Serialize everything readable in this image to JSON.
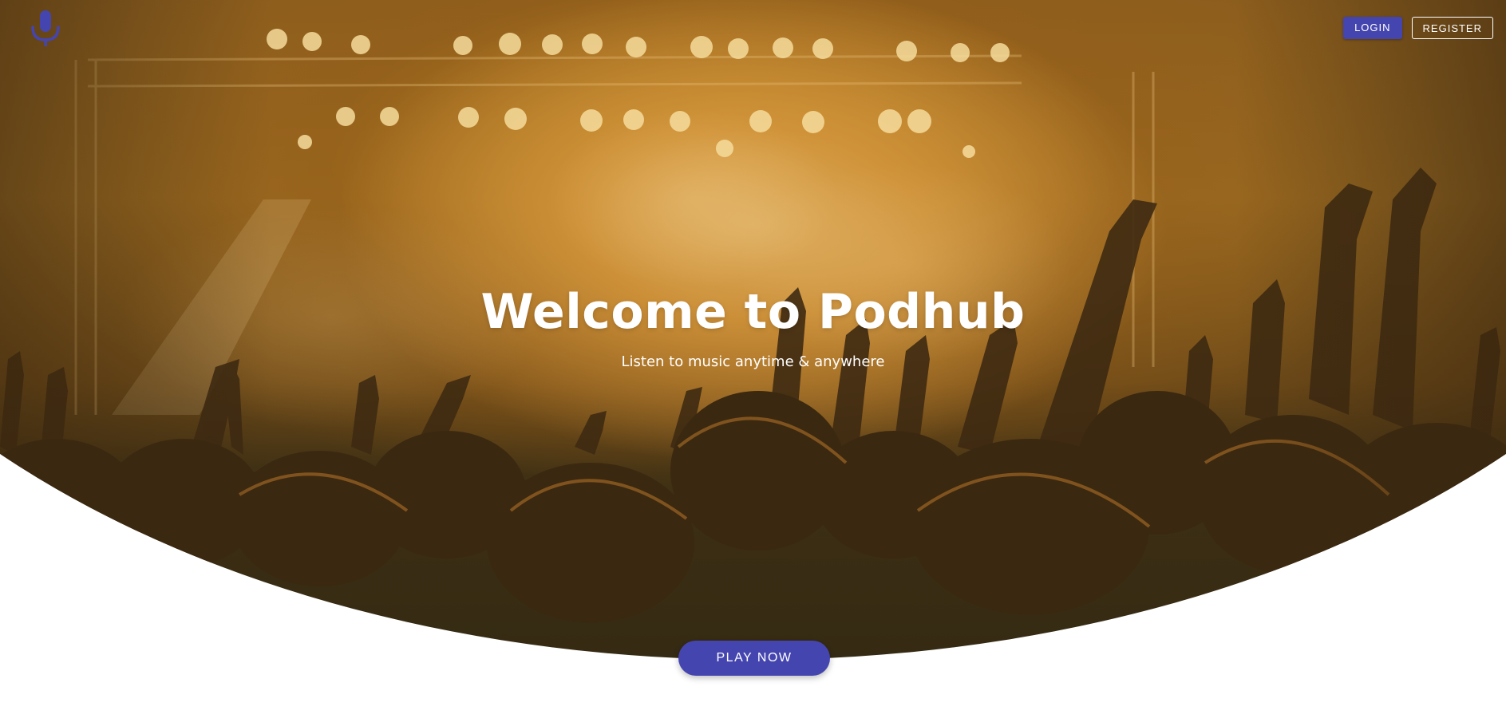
{
  "app": {
    "logo_icon": "microphone-icon",
    "accent_color": "#4545b0"
  },
  "header": {
    "login_label": "LOGIN",
    "register_label": "REGISTER"
  },
  "hero": {
    "background_image": "concert crowd with raised hands under warm amber stage lights",
    "title": "Welcome to Podhub",
    "subtitle": "Listen to music anytime & anywhere"
  },
  "cta": {
    "play_label": "PLAY NOW"
  }
}
